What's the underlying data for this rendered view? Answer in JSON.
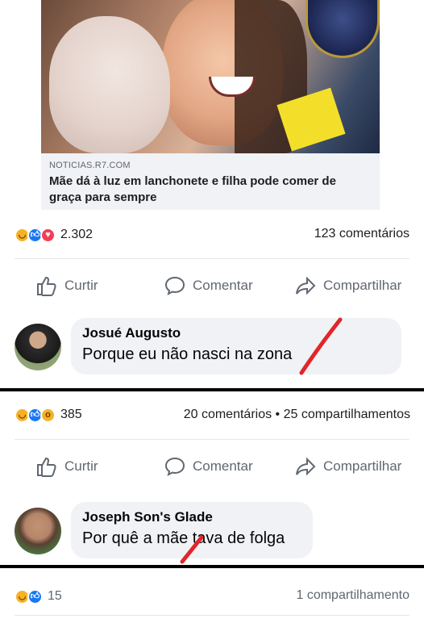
{
  "post1": {
    "preview": {
      "domain": "NOTICIAS.R7.COM",
      "headline": "Mãe dá à luz em lanchonete e filha pode comer de graça para sempre"
    },
    "reactions": {
      "count": "2.302",
      "icons": [
        "haha-icon",
        "like-icon",
        "love-icon"
      ]
    },
    "comments_count": "123 comentários",
    "actions": {
      "like": "Curtir",
      "comment": "Comentar",
      "share": "Compartilhar"
    },
    "comment": {
      "author": "Josué Augusto",
      "text": "Porque eu não nasci na zona"
    }
  },
  "post2": {
    "reactions": {
      "count": "385",
      "icons": [
        "haha-icon",
        "like-icon",
        "wow-icon"
      ]
    },
    "stats": "20 comentários • 25 compartilhamentos",
    "actions": {
      "like": "Curtir",
      "comment": "Comentar",
      "share": "Compartilhar"
    },
    "comment": {
      "author": "Joseph Son's Glade",
      "text": "Por quê a mãe tava de folga"
    }
  },
  "post3": {
    "reactions": {
      "count": "15",
      "icons": [
        "haha-icon",
        "like-icon"
      ]
    },
    "shares": "1 compartilhamento"
  },
  "colors": {
    "accent_blue": "#1877f2",
    "annotation_red": "#e0262b",
    "text_gray": "#606770"
  }
}
